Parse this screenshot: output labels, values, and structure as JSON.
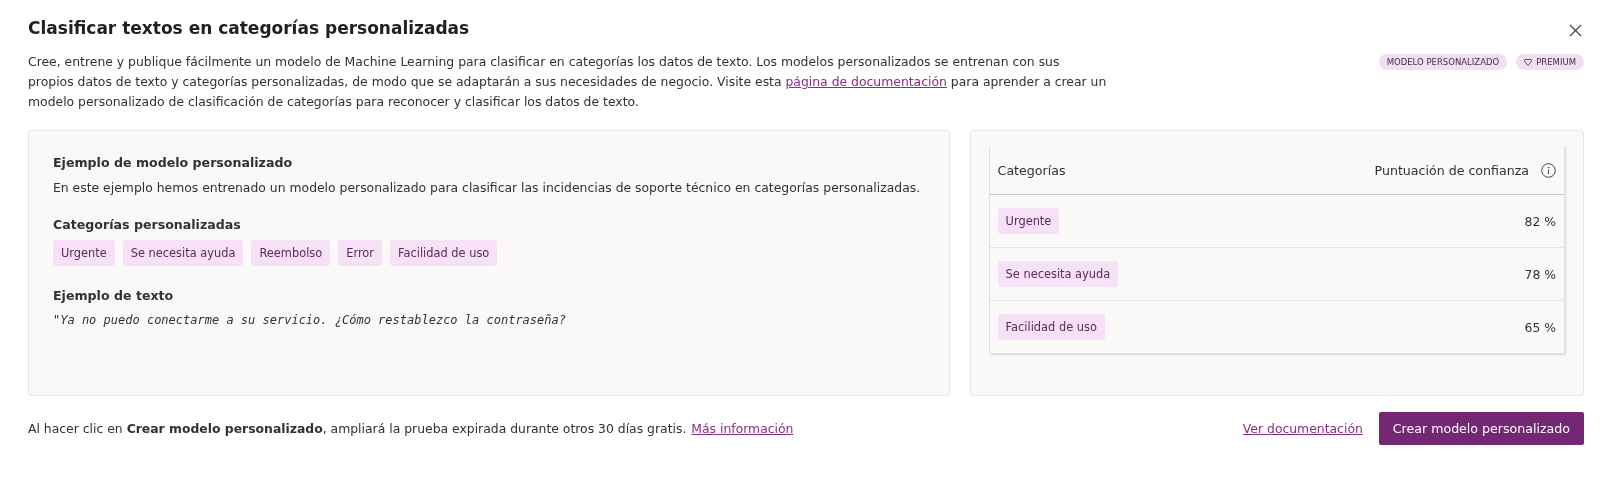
{
  "dialog": {
    "title": "Clasificar textos en categorías personalizadas",
    "description_before": "Cree, entrene y publique fácilmente un modelo de Machine Learning para clasificar en categorías los datos de texto. Los modelos personalizados se entrenan con sus propios datos de texto y categorías personalizadas, de modo que se adaptarán a sus necesidades de negocio. Visite esta",
    "description_link": "página de documentación",
    "description_after": "para aprender a crear un modelo personalizado de clasificación de categorías para reconocer y clasificar los datos de texto.",
    "badges": [
      {
        "label": "MODELO PERSONALIZADO",
        "kind": "plain"
      },
      {
        "label": "PREMIUM",
        "kind": "premium"
      }
    ]
  },
  "example": {
    "heading": "Ejemplo de modelo personalizado",
    "body": "En este ejemplo hemos entrenado un modelo personalizado para clasificar las incidencias de soporte técnico en categorías personalizadas.",
    "categories_heading": "Categorías personalizadas",
    "categories": [
      "Urgente",
      "Se necesita ayuda",
      "Reembolso",
      "Error",
      "Facilidad de uso"
    ],
    "text_heading": "Ejemplo de texto",
    "sample_text": "\"Ya no puedo conectarme a su servicio. ¿Cómo restablezco la contraseña?"
  },
  "results": {
    "columns": [
      "Categorías",
      "Puntuación de confianza"
    ],
    "rows": [
      {
        "category": "Urgente",
        "score": "82 %"
      },
      {
        "category": "Se necesita ayuda",
        "score": "78 %"
      },
      {
        "category": "Facilidad de uso",
        "score": "65 %"
      }
    ]
  },
  "footer": {
    "notice": "Al hacer clic en **Crear modelo personalizado**, ampliará la prueba expirada durante otros 30 días gratis.",
    "more_link": "Más información",
    "docs_link": "Ver documentación",
    "create_button": "Crear modelo personalizado"
  }
}
